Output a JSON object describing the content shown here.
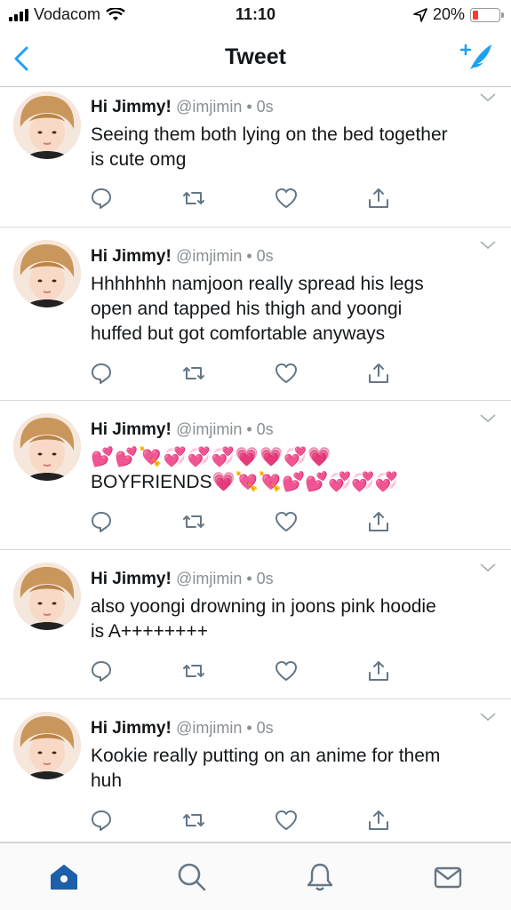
{
  "status": {
    "carrier": "Vodacom",
    "time": "11:10",
    "battery": "20%",
    "battery_level": 0.2
  },
  "nav": {
    "title": "Tweet",
    "back_icon": "chevron-left-icon",
    "compose_icon": "compose-tweet-icon",
    "accent": "#1da1f2"
  },
  "tweets": [
    {
      "name": "Hi Jimmy!",
      "handle": "@imjimin • 0s",
      "lines": [
        "Seeing them both lying on the bed together",
        "is cute omg"
      ]
    },
    {
      "name": "Hi Jimmy!",
      "handle": "@imjimin • 0s",
      "lines": [
        "Hhhhhhh namjoon really spread his legs",
        "open and tapped his thigh and yoongi",
        "huffed but got comfortable anyways"
      ]
    },
    {
      "name": "Hi Jimmy!",
      "handle": "@imjimin • 0s",
      "lines": [
        "💕💕💘💞💞💞💗💗💞💗",
        "BOYFRIENDS💗💘💘💕💕💞💞💞"
      ]
    },
    {
      "name": "Hi Jimmy!",
      "handle": "@imjimin • 0s",
      "lines": [
        "also yoongi drowning in joons pink hoodie",
        "is A++++++++"
      ]
    },
    {
      "name": "Hi Jimmy!",
      "handle": "@imjimin • 0s",
      "lines": [
        "Kookie really putting on an anime for them",
        "huh"
      ]
    }
  ],
  "tabs": [
    "home-icon",
    "search-icon",
    "notifications-bell-icon",
    "messages-envelope-icon"
  ]
}
